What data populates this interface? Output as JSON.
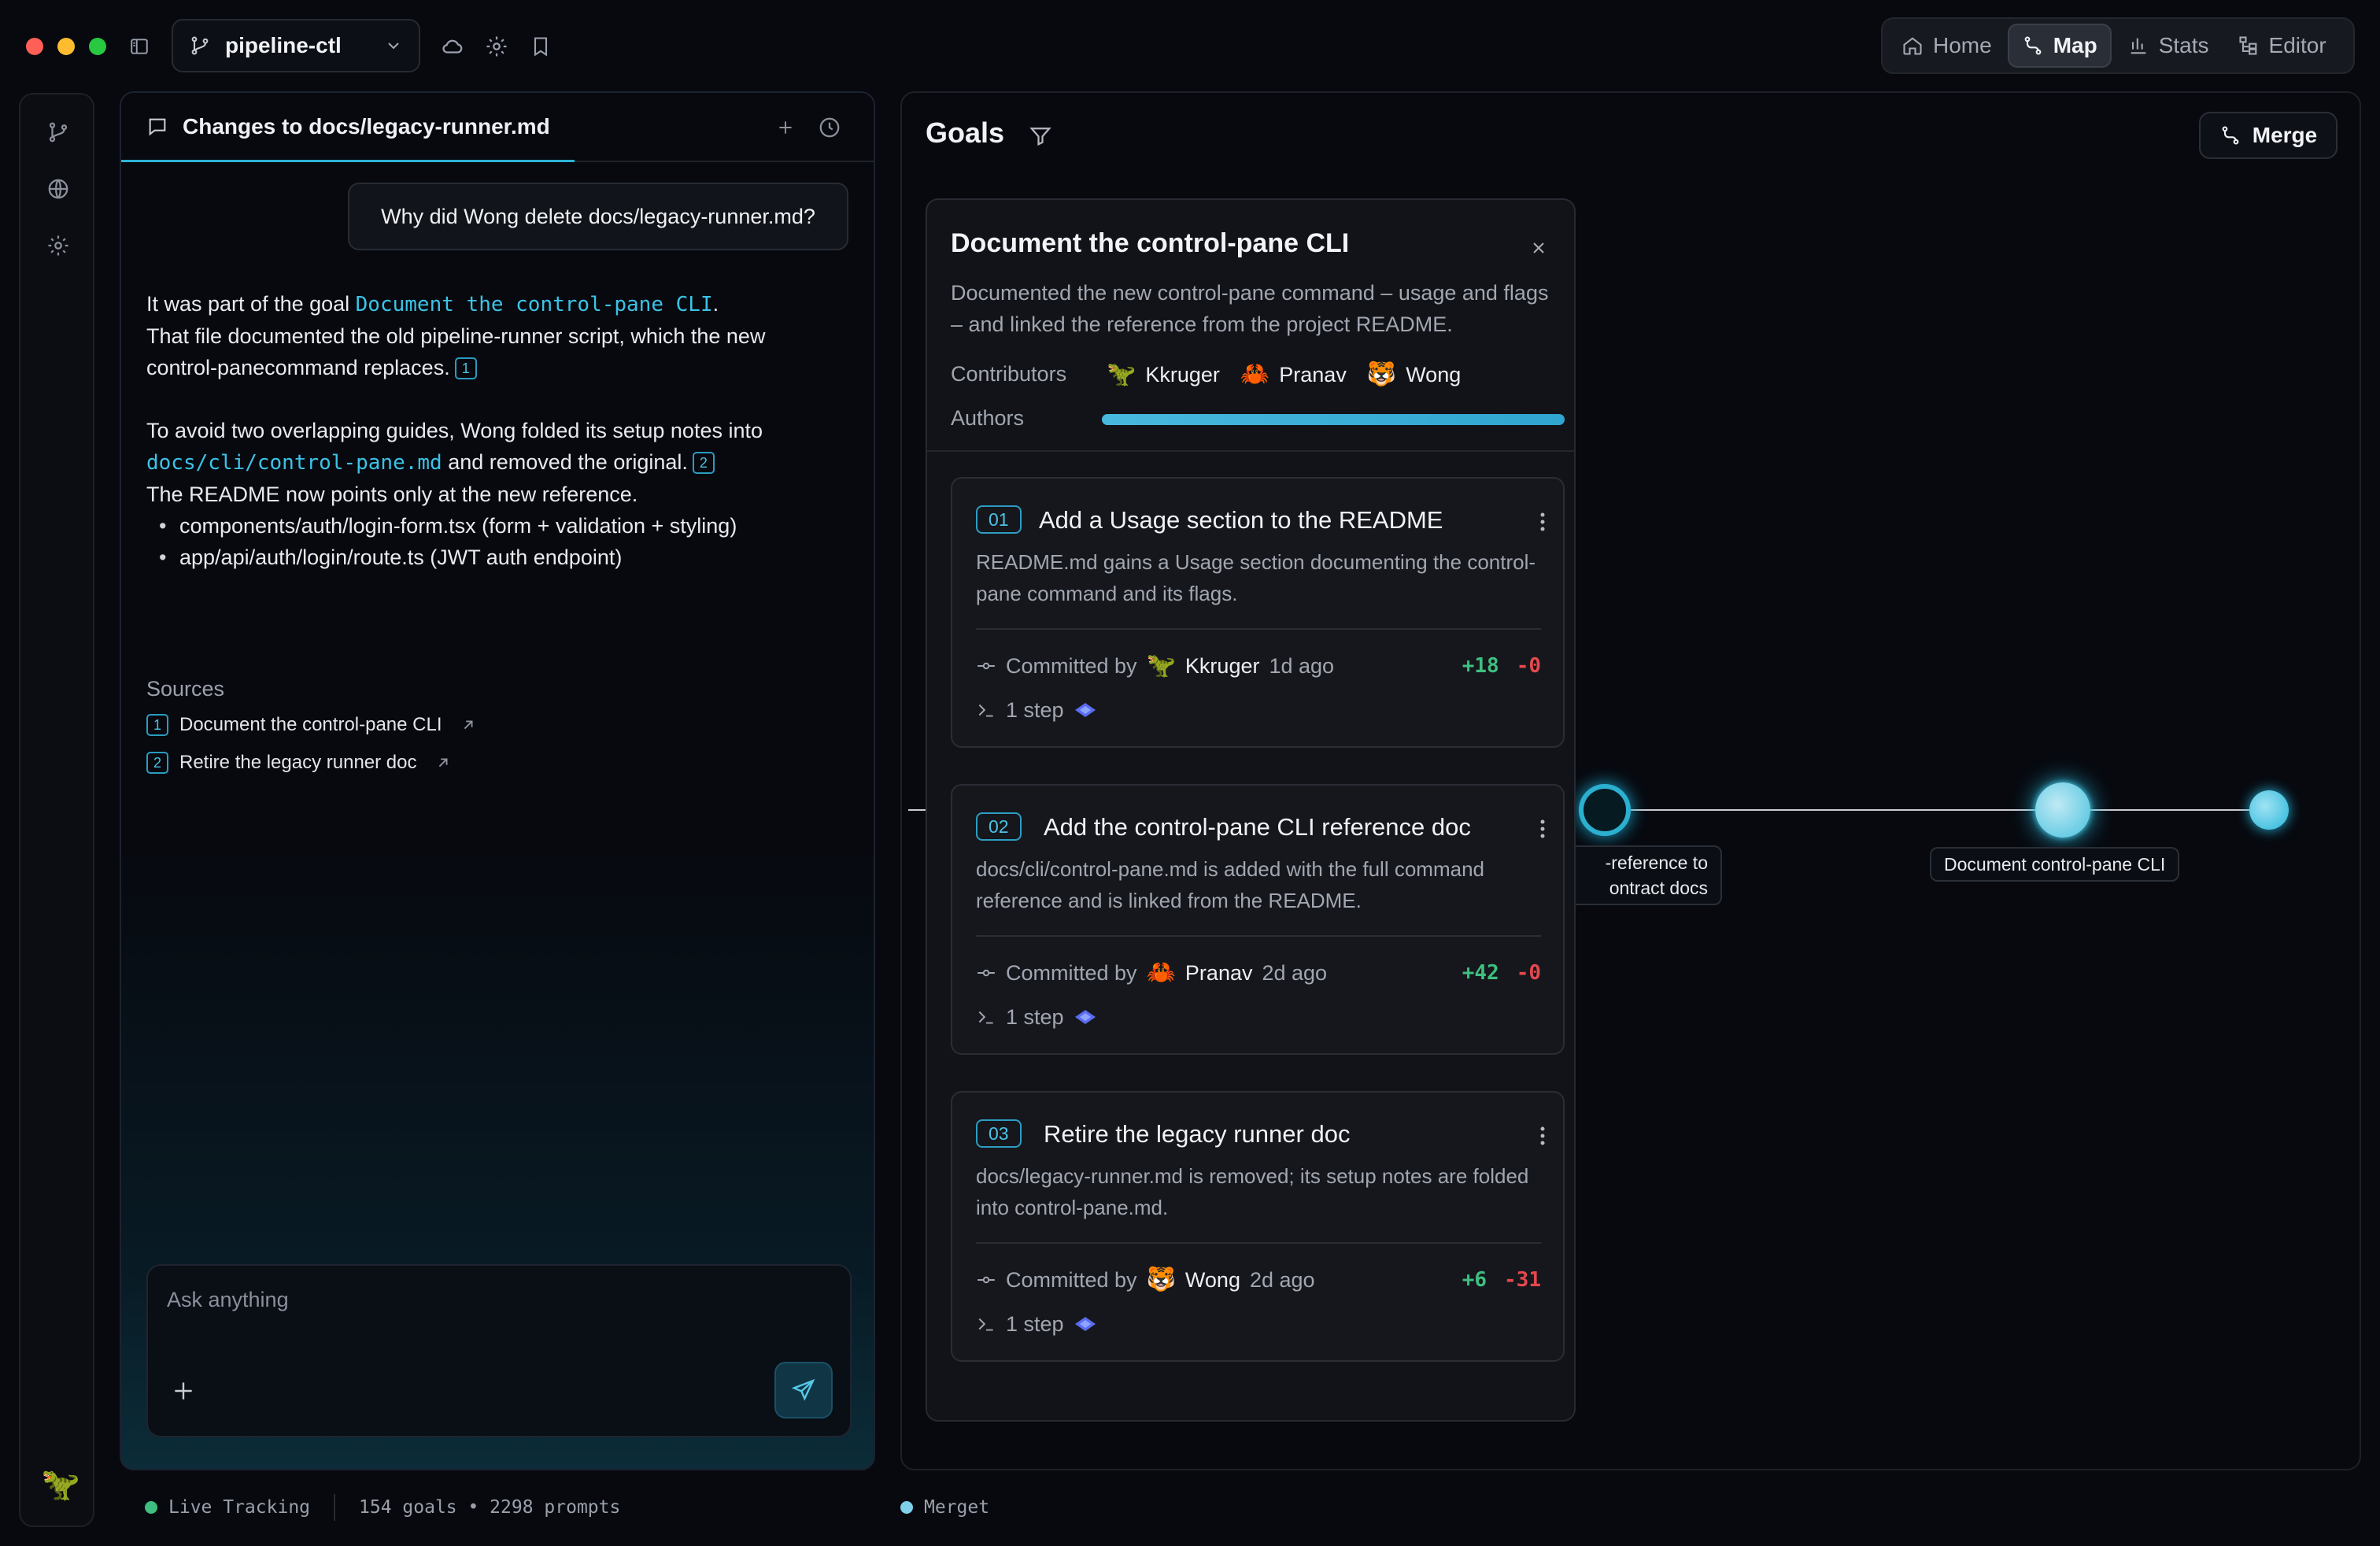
{
  "window": {
    "repo_name": "pipeline-ctl"
  },
  "nav": {
    "tabs": [
      {
        "label": "Home"
      },
      {
        "label": "Map"
      },
      {
        "label": "Stats"
      },
      {
        "label": "Editor"
      }
    ],
    "active": "Map"
  },
  "chat": {
    "tab_title": "Changes to docs/legacy-runner.md",
    "user_message": "Why did Wong delete docs/legacy-runner.md?",
    "answer": {
      "p1_prefix": "It was part of the goal ",
      "p1_goal_link": "Document the control-pane CLI",
      "p1_suffix": ".",
      "p1_line2": "That file documented the old pipeline-runner script, which the new control-panecommand replaces.",
      "p1_cite": "1",
      "p2_prefix": "To avoid two overlapping guides, Wong folded its setup notes into ",
      "p2_path_link": "docs/cli/control-pane.md",
      "p2_suffix": " and removed the original.",
      "p2_cite": "2",
      "p2_line2": "The README now points only at the new reference.",
      "bullets": [
        "components/auth/login-form.tsx (form + validation + styling)",
        "app/api/auth/login/route.ts (JWT auth endpoint)"
      ]
    },
    "sources_title": "Sources",
    "sources": [
      {
        "num": "1",
        "label": "Document the control-pane CLI"
      },
      {
        "num": "2",
        "label": "Retire the legacy runner doc"
      }
    ],
    "composer_placeholder": "Ask anything"
  },
  "status": {
    "tracking": "Live Tracking",
    "counts": "154 goals • 2298 prompts",
    "merget": "Merget",
    "tracking_color": "#3fbf7f",
    "merget_color": "#7fd0ea"
  },
  "goals": {
    "title": "Goals",
    "merge_label": "Merge",
    "map_labels": {
      "partial_line1": "-reference to",
      "partial_line2": "ontract docs",
      "main_node": "Document control-pane CLI"
    },
    "card": {
      "title": "Document the control-pane CLI",
      "description": "Documented the new control-pane command – usage and flags – and linked the reference from the project README.",
      "contributors_label": "Contributors",
      "authors_label": "Authors",
      "contributors": [
        {
          "emoji": "🦖",
          "name": "Kkruger"
        },
        {
          "emoji": "🦀",
          "name": "Pranav"
        },
        {
          "emoji": "🐯",
          "name": "Wong"
        }
      ],
      "steps": [
        {
          "num": "01",
          "title": "Add a Usage section to the README",
          "description": "README.md gains a Usage section documenting the control-pane command and its flags.",
          "committed_by_label": "Committed by",
          "author_emoji": "🦖",
          "author": "Kkruger",
          "when": "1d ago",
          "added": "+18",
          "removed": "-0",
          "steps_label": "1 step"
        },
        {
          "num": "02",
          "title": "Add the control-pane CLI reference doc",
          "description": "docs/cli/control-pane.md is added with the full command reference and is linked from the README.",
          "committed_by_label": "Committed by",
          "author_emoji": "🦀",
          "author": "Pranav",
          "when": "2d ago",
          "added": "+42",
          "removed": "-0",
          "steps_label": "1 step"
        },
        {
          "num": "03",
          "title": "Retire the legacy runner doc",
          "description": "docs/legacy-runner.md is removed; its setup notes are folded into control-pane.md.",
          "committed_by_label": "Committed by",
          "author_emoji": "🐯",
          "author": "Wong",
          "when": "2d ago",
          "added": "+6",
          "removed": "-31",
          "steps_label": "1 step"
        }
      ]
    }
  },
  "user_avatar_emoji": "🦖",
  "colors": {
    "accent": "#2bb3d6",
    "added": "#3fbf7f",
    "removed": "#e5484d"
  }
}
